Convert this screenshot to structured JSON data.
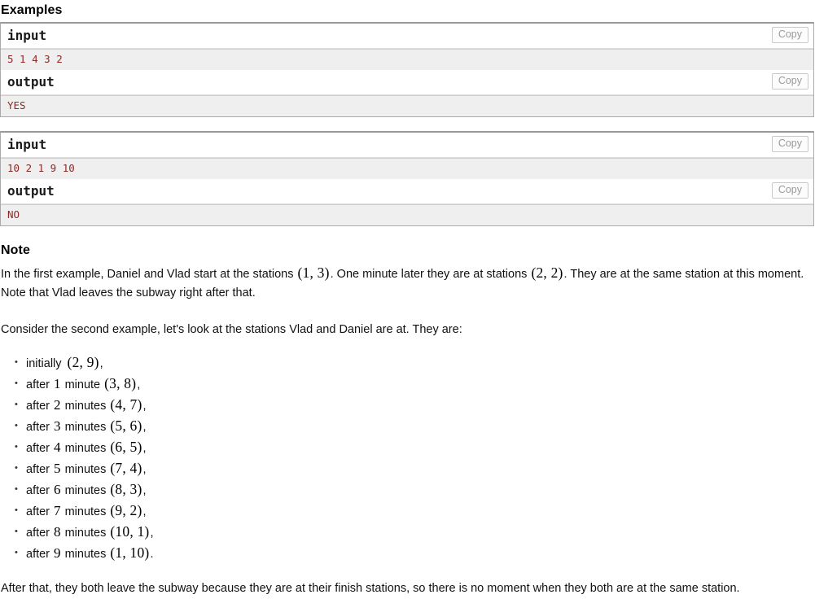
{
  "examples": {
    "heading": "Examples",
    "copy_label": "Copy",
    "blocks": [
      {
        "input_title": "input",
        "input_data": "5 1 4 3 2",
        "output_title": "output",
        "output_data": "YES"
      },
      {
        "input_title": "input",
        "input_data": "10 2 1 9 10",
        "output_title": "output",
        "output_data": "NO"
      }
    ]
  },
  "note": {
    "heading": "Note",
    "para1_a": "In the first example, Daniel and Vlad start at the stations ",
    "para1_math1": "(1, 3)",
    "para1_b": ". One minute later they are at stations ",
    "para1_math2": "(2, 2)",
    "para1_c": ". They are at the same station at this moment. Note that Vlad leaves the subway right after that.",
    "para2": "Consider the second example, let's look at the stations Vlad and Daniel are at. They are:",
    "list": [
      {
        "prefix": "initially ",
        "minutes": "",
        "suffix": "",
        "pair": "(2, 9)",
        "punct": ","
      },
      {
        "prefix": "after ",
        "minutes": "1",
        "suffix": " minute ",
        "pair": "(3, 8)",
        "punct": ","
      },
      {
        "prefix": "after ",
        "minutes": "2",
        "suffix": " minutes ",
        "pair": "(4, 7)",
        "punct": ","
      },
      {
        "prefix": "after ",
        "minutes": "3",
        "suffix": " minutes ",
        "pair": "(5, 6)",
        "punct": ","
      },
      {
        "prefix": "after ",
        "minutes": "4",
        "suffix": " minutes ",
        "pair": "(6, 5)",
        "punct": ","
      },
      {
        "prefix": "after ",
        "minutes": "5",
        "suffix": " minutes ",
        "pair": "(7, 4)",
        "punct": ","
      },
      {
        "prefix": "after ",
        "minutes": "6",
        "suffix": " minutes ",
        "pair": "(8, 3)",
        "punct": ","
      },
      {
        "prefix": "after ",
        "minutes": "7",
        "suffix": " minutes ",
        "pair": "(9, 2)",
        "punct": ","
      },
      {
        "prefix": "after ",
        "minutes": "8",
        "suffix": " minutes ",
        "pair": "(10, 1)",
        "punct": ","
      },
      {
        "prefix": "after ",
        "minutes": "9",
        "suffix": " minutes ",
        "pair": "(1, 10)",
        "punct": "."
      }
    ],
    "para3": "After that, they both leave the subway because they are at their finish stations, so there is no moment when they both are at the same station."
  },
  "colors": {
    "sample_data_text": "#8c2a28",
    "sample_data_bg": "#efefef",
    "border": "#aaaaaa",
    "copy_text": "#9a9a9a"
  }
}
